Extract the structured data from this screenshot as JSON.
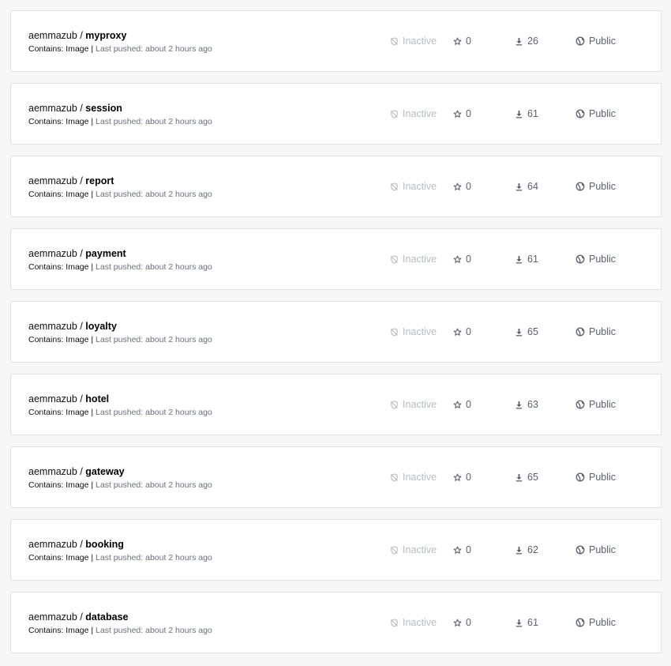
{
  "labels": {
    "separator": "/",
    "contains_prefix": "Contains:",
    "pipe": "|",
    "last_pushed_prefix": "Last pushed:"
  },
  "colors": {
    "row_background": "#ffffff",
    "row_border": "#e1e2e6",
    "inactive_text": "#b9bcc4",
    "muted_text": "#6b6f7b"
  },
  "icons": {
    "status": "inactive-shield-icon",
    "stars": "star-icon",
    "pulls": "download-icon",
    "visibility": "globe-icon"
  },
  "repositories": [
    {
      "owner": "aemmazub",
      "name": "myproxy",
      "contains": "Image",
      "last_pushed": "about 2 hours ago",
      "status": "Inactive",
      "stars": "0",
      "pulls": "26",
      "visibility": "Public"
    },
    {
      "owner": "aemmazub",
      "name": "session",
      "contains": "Image",
      "last_pushed": "about 2 hours ago",
      "status": "Inactive",
      "stars": "0",
      "pulls": "61",
      "visibility": "Public"
    },
    {
      "owner": "aemmazub",
      "name": "report",
      "contains": "Image",
      "last_pushed": "about 2 hours ago",
      "status": "Inactive",
      "stars": "0",
      "pulls": "64",
      "visibility": "Public"
    },
    {
      "owner": "aemmazub",
      "name": "payment",
      "contains": "Image",
      "last_pushed": "about 2 hours ago",
      "status": "Inactive",
      "stars": "0",
      "pulls": "61",
      "visibility": "Public"
    },
    {
      "owner": "aemmazub",
      "name": "loyalty",
      "contains": "Image",
      "last_pushed": "about 2 hours ago",
      "status": "Inactive",
      "stars": "0",
      "pulls": "65",
      "visibility": "Public"
    },
    {
      "owner": "aemmazub",
      "name": "hotel",
      "contains": "Image",
      "last_pushed": "about 2 hours ago",
      "status": "Inactive",
      "stars": "0",
      "pulls": "63",
      "visibility": "Public"
    },
    {
      "owner": "aemmazub",
      "name": "gateway",
      "contains": "Image",
      "last_pushed": "about 2 hours ago",
      "status": "Inactive",
      "stars": "0",
      "pulls": "65",
      "visibility": "Public"
    },
    {
      "owner": "aemmazub",
      "name": "booking",
      "contains": "Image",
      "last_pushed": "about 2 hours ago",
      "status": "Inactive",
      "stars": "0",
      "pulls": "62",
      "visibility": "Public"
    },
    {
      "owner": "aemmazub",
      "name": "database",
      "contains": "Image",
      "last_pushed": "about 2 hours ago",
      "status": "Inactive",
      "stars": "0",
      "pulls": "61",
      "visibility": "Public"
    }
  ]
}
